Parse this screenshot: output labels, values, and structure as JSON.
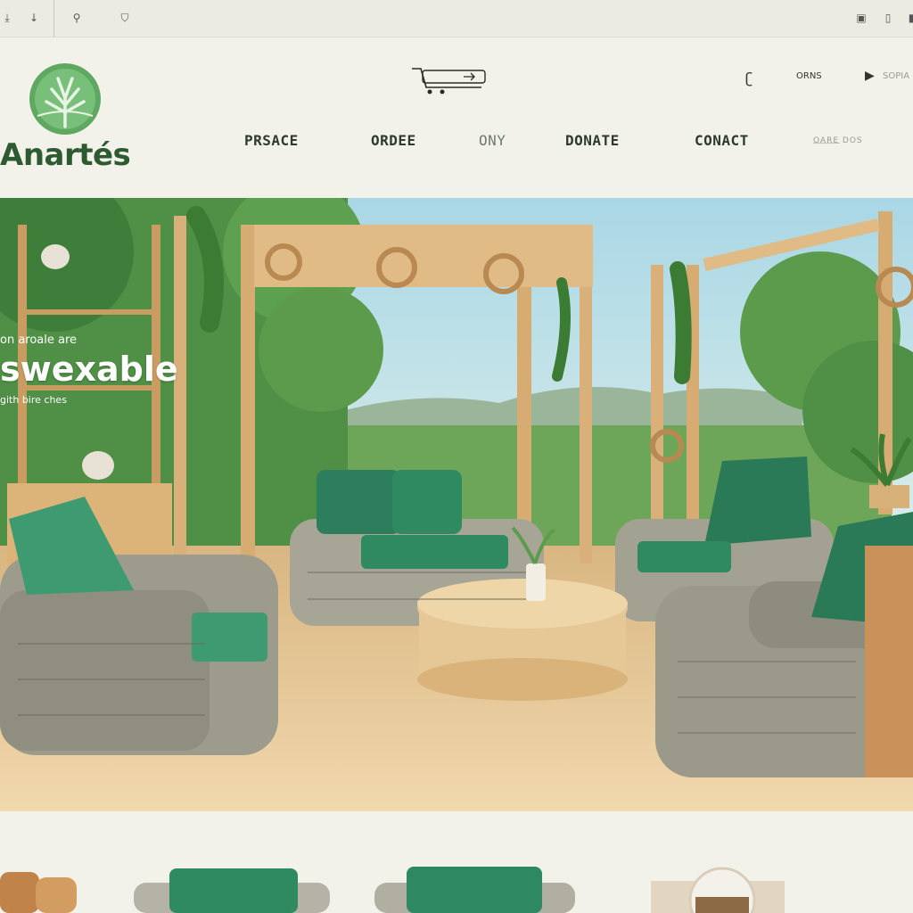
{
  "browser": {
    "icons": [
      "download-icon",
      "arrow-down-icon",
      "location-pin-icon",
      "shield-icon",
      "window-icon",
      "tab-icon",
      "tabs-icon"
    ]
  },
  "header": {
    "brand": "Anartés",
    "utility_label": "ORNS",
    "utility_right": "SOPIA",
    "nav": [
      {
        "label": "PRSACE"
      },
      {
        "label": "ORDEE"
      },
      {
        "label": "ONY"
      },
      {
        "label": "DONATE"
      },
      {
        "label": "CONACT"
      }
    ],
    "nav_extra": "OARE DOS"
  },
  "hero": {
    "eyebrow": "on aroale are",
    "headline": "swexable",
    "subtext": "gith bire ches"
  },
  "colors": {
    "brand_green": "#2e5a32",
    "accent_teal": "#2f8a62",
    "background": "#f1f0e8"
  }
}
